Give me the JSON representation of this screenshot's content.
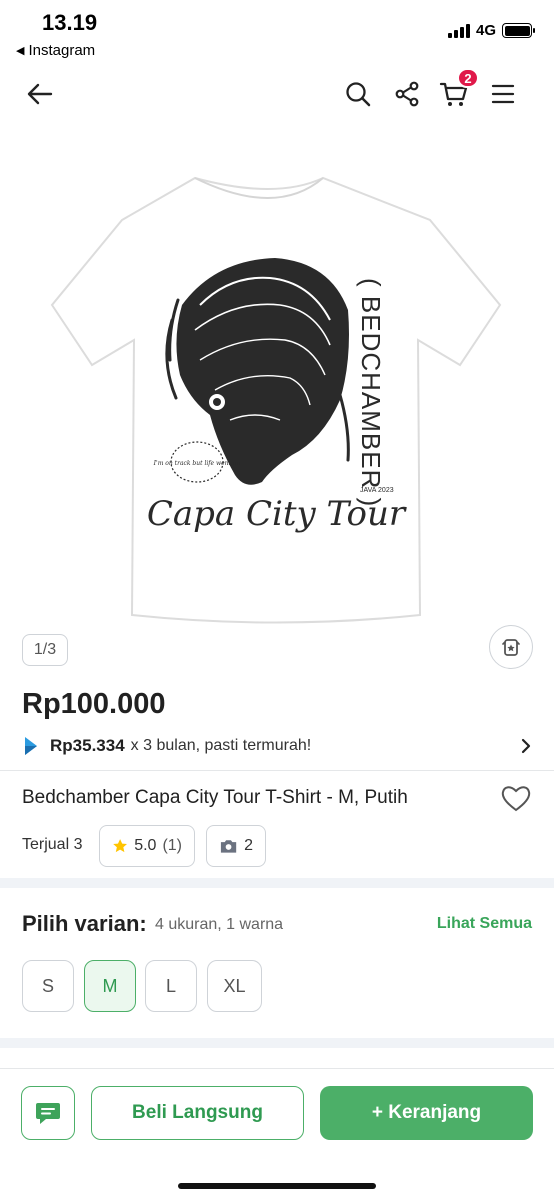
{
  "status_bar": {
    "time": "13.19",
    "back_app": "Instagram",
    "network": "4G"
  },
  "nav": {
    "cart_count": "2"
  },
  "product": {
    "image_counter": "1/3",
    "price": "Rp100.000",
    "installment_amount": "Rp35.334",
    "installment_text": "x 3 bulan, pasti termurah!",
    "title": "Bedchamber Capa City Tour T-Shirt - M, Putih",
    "sold": "Terjual 3",
    "rating": "5.0",
    "rating_count": "(1)",
    "photo_count": "2",
    "shirt_print": {
      "band": "( BEDCHAMBER )",
      "tour": "Capa City Tour",
      "tour_year": "JAVA 2023",
      "script_note": "I'm on track but life went on"
    }
  },
  "variants": {
    "title": "Pilih varian:",
    "summary": "4 ukuran, 1 warna",
    "see_all": "Lihat Semua",
    "sizes": [
      "S",
      "M",
      "L",
      "XL"
    ],
    "selected": "M"
  },
  "actions": {
    "buy_now": "Beli Langsung",
    "add_to_cart": "+ Keranjang"
  },
  "colors": {
    "accent_green": "#4caf68",
    "badge_red": "#e0194a"
  }
}
